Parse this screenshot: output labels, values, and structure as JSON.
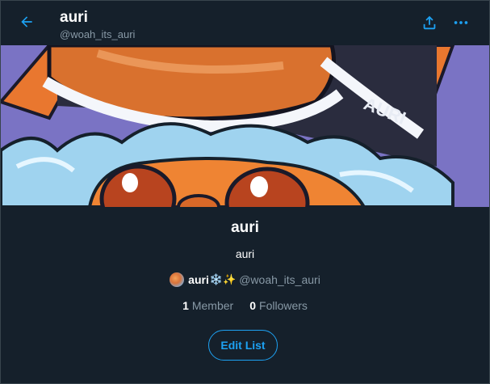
{
  "header": {
    "title": "auri",
    "handle": "@woah_its_auri",
    "back_icon": "arrow-left-icon",
    "share_icon": "share-icon",
    "more_icon": "more-dots-icon"
  },
  "banner": {
    "description": "auri-character-banner",
    "cap_text": "AURI"
  },
  "list": {
    "name": "auri",
    "description": "auri",
    "owner": {
      "name": "auri",
      "emoji": "❄️✨",
      "handle": "@woah_its_auri"
    },
    "stats": {
      "members_count": "1",
      "members_label": "Member",
      "followers_count": "0",
      "followers_label": "Followers"
    },
    "edit_label": "Edit List"
  },
  "colors": {
    "background": "#15202b",
    "accent": "#1da1f2",
    "secondary_text": "#8899a6",
    "border": "#38444d"
  }
}
